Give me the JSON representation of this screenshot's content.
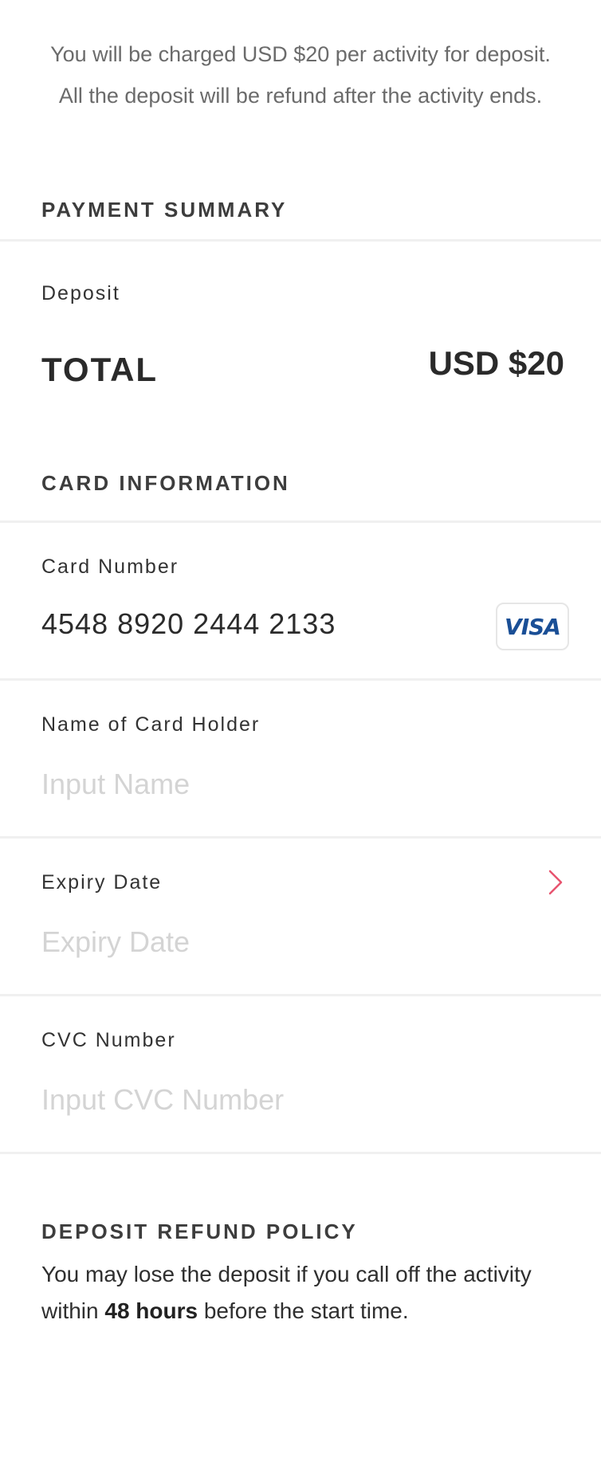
{
  "intro": {
    "text": "You will be charged USD $20 per activity for deposit. All the deposit will be refund after the activity ends."
  },
  "payment_summary": {
    "title": "PAYMENT SUMMARY",
    "deposit_label": "Deposit",
    "total_label": "TOTAL",
    "total_value": "USD $20"
  },
  "card_information": {
    "title": "CARD INFORMATION",
    "card_number": {
      "label": "Card Number",
      "value": "4548 8920 2444 2133",
      "brand": "VISA",
      "brand_color": "#1a4f96"
    },
    "card_holder": {
      "label": "Name of Card Holder",
      "value": "",
      "placeholder": "Input Name"
    },
    "expiry": {
      "label": "Expiry Date",
      "value": "",
      "placeholder": "Expiry Date",
      "chevron_icon": "chevron-right-icon",
      "chevron_color": "#e8546f"
    },
    "cvc": {
      "label": "CVC Number",
      "value": "",
      "placeholder": "Input CVC Number"
    }
  },
  "refund_policy": {
    "title": "DEPOSIT REFUND POLICY",
    "text_before": "You may lose the deposit if you call off the activity within ",
    "text_bold": "48 hours",
    "text_after": " before the start time."
  }
}
